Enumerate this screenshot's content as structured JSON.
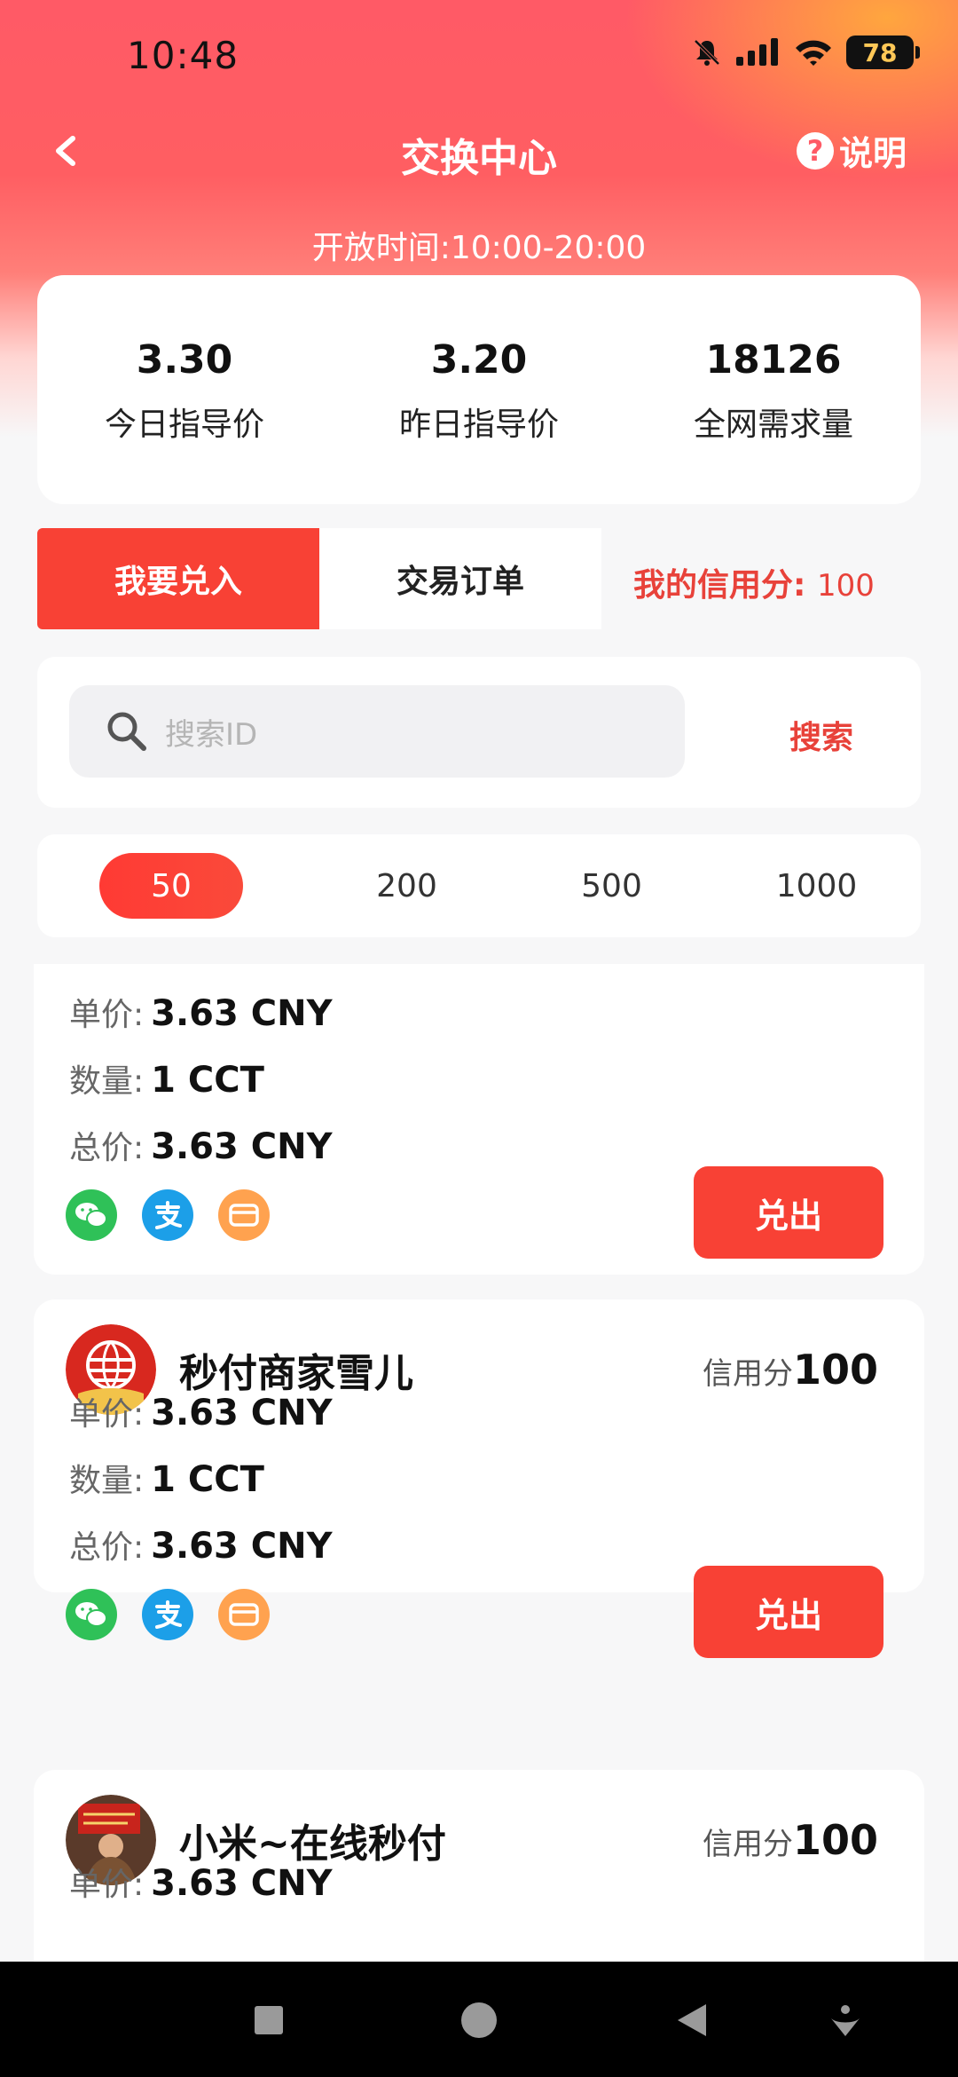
{
  "status_bar": {
    "time": "10:48",
    "battery": "78"
  },
  "header": {
    "title": "交换中心",
    "help_label": "说明",
    "help_glyph": "?",
    "open_hours": "开放时间:10:00-20:00"
  },
  "stats": [
    {
      "value": "3.30",
      "label": "今日指导价"
    },
    {
      "value": "3.20",
      "label": "昨日指导价"
    },
    {
      "value": "18126",
      "label": "全网需求量"
    }
  ],
  "tabs": [
    {
      "label": "我要兑入",
      "active": true
    },
    {
      "label": "交易订单",
      "active": false
    }
  ],
  "credit": {
    "label": "我的信用分:",
    "value": "100"
  },
  "search": {
    "placeholder": "搜索ID",
    "button": "搜索"
  },
  "amounts": [
    {
      "label": "50",
      "active": true
    },
    {
      "label": "200"
    },
    {
      "label": "500"
    },
    {
      "label": "1000"
    }
  ],
  "field_labels": {
    "price": "单价:",
    "quantity": "数量:",
    "total": "总价:",
    "credit": "信用分"
  },
  "offers": [
    {
      "seller": "",
      "credit": "",
      "price": "3.63 CNY",
      "quantity": "1 CCT",
      "total": "3.63 CNY",
      "action": "兑出"
    },
    {
      "seller": "秒付商家雪儿",
      "credit": "100",
      "price": "3.63 CNY",
      "quantity": "1 CCT",
      "total": "3.63 CNY",
      "action": "兑出"
    },
    {
      "seller": "小米~在线秒付",
      "credit": "100",
      "price": "3.63 CNY",
      "quantity": "",
      "total": "",
      "action": ""
    }
  ],
  "payment_icons": [
    "wechat-pay-icon",
    "alipay-icon",
    "bank-card-icon"
  ],
  "colors": {
    "accent": "#f84135",
    "credit_text": "#e8423a",
    "wechat": "#2fc158",
    "alipay": "#1c9fe8",
    "card": "#ffa24f"
  }
}
